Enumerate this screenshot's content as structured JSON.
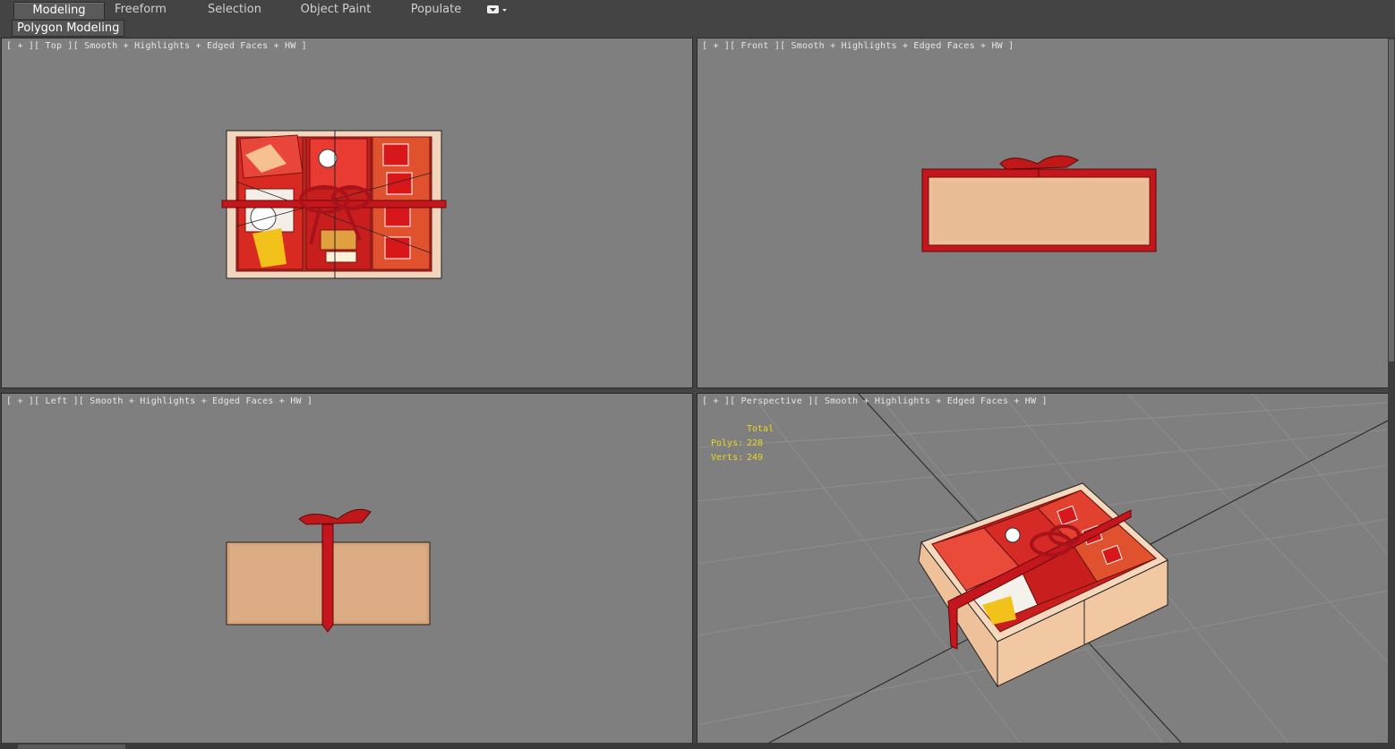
{
  "ribbon": {
    "tabs": [
      {
        "label": "Modeling",
        "active": true
      },
      {
        "label": "Freeform",
        "active": false
      },
      {
        "label": "Selection",
        "active": false
      },
      {
        "label": "Object Paint",
        "active": false
      },
      {
        "label": "Populate",
        "active": false
      }
    ],
    "dropdown_icon": "chevron-down-icon",
    "subtab_label": "Polygon Modeling"
  },
  "viewports": {
    "top": {
      "label": "[ + ][ Top ][ Smooth + Highlights + Edged Faces + HW ]"
    },
    "front": {
      "label": "[ + ][ Front ][ Smooth + Highlights + Edged Faces + HW ]"
    },
    "left": {
      "label": "[ + ][ Left ][ Smooth + Highlights + Edged Faces + HW ]"
    },
    "perspective": {
      "label": "[ + ][ Perspective ][ Smooth + Highlights + Edged Faces + HW ]",
      "stats": {
        "header": "Total",
        "polys_label": "Polys:",
        "polys_value": "228",
        "verts_label": "Verts:",
        "verts_value": "249"
      }
    }
  },
  "colors": {
    "viewport_bg": "#7f7f7f",
    "ribbon_red": "#c4161c",
    "box_beige": "#e9bf98",
    "stats_yellow": "#e8d820"
  }
}
